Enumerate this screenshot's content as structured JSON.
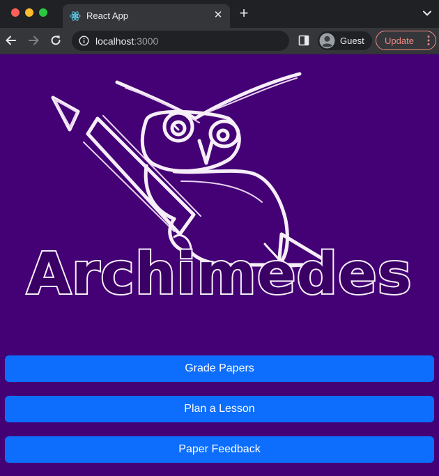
{
  "browser": {
    "tab_title": "React App",
    "url_host": "localhost",
    "url_port": ":3000",
    "profile_label": "Guest",
    "update_label": "Update",
    "tab_close_glyph": "✕",
    "new_tab_glyph": "+"
  },
  "page": {
    "brand_name": "Archimedes",
    "background_color": "#440075",
    "logo_icon": "owl-with-pencil-icon",
    "buttons": [
      {
        "label": "Grade Papers"
      },
      {
        "label": "Plan a Lesson"
      },
      {
        "label": "Paper Feedback"
      }
    ],
    "button_color": "#0d6efd"
  }
}
